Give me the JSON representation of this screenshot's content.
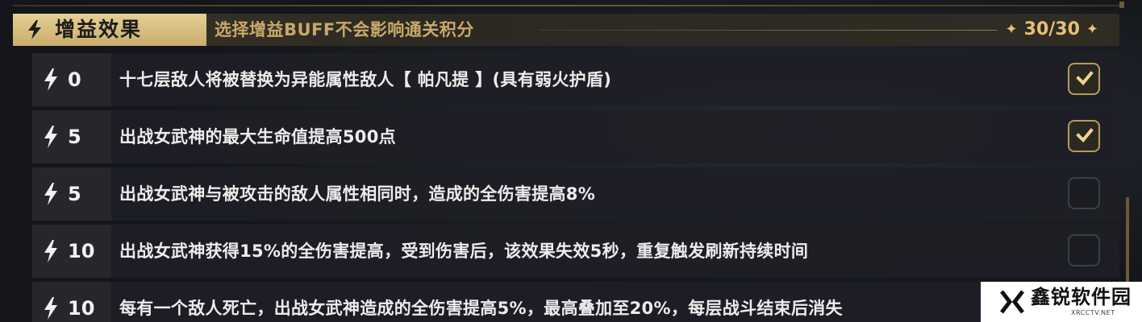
{
  "header": {
    "title": "增益效果",
    "note": "选择增益BUFF不会影响通关积分",
    "score": "30/30",
    "score_star_left": "✦",
    "score_star_right": "✦",
    "icon": "lightning-bolt-icon"
  },
  "colors": {
    "gold": "#e4c174",
    "tab_gold": "#d8bd7d",
    "row_bg": "#1e2026",
    "cost_bg": "#25272d",
    "text": "#ececec"
  },
  "rows": [
    {
      "cost": "0",
      "desc": "十七层敌人将被替换为异能属性敌人【 帕凡提 】(具有弱火护盾)",
      "checked": true
    },
    {
      "cost": "5",
      "desc": "出战女武神的最大生命值提高500点",
      "checked": true
    },
    {
      "cost": "5",
      "desc": "出战女武神与被攻击的敌人属性相同时，造成的全伤害提高8%",
      "checked": false
    },
    {
      "cost": "10",
      "desc": "出战女武神获得15%的全伤害提高，受到伤害后，该效果失效5秒，重复触发刷新持续时间",
      "checked": false
    },
    {
      "cost": "10",
      "desc": "每有一个敌人死亡，出战女武神造成的全伤害提高5%，最高叠加至20%，每层战斗结束后消失",
      "checked": false
    }
  ],
  "watermark": {
    "name": "鑫锐软件园",
    "sub": "XRCCTV.NET"
  }
}
